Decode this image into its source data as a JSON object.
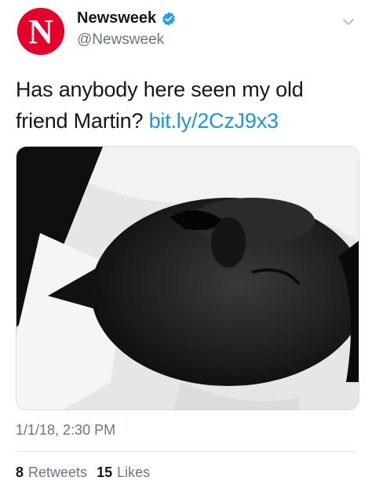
{
  "account": {
    "display_name": "Newsweek",
    "handle": "@Newsweek",
    "avatar_letter": "N",
    "verified": true
  },
  "tweet": {
    "text": "Has anybody here seen my old friend Martin?",
    "link": "bit.ly/2CzJ9x3",
    "timestamp": "1/1/18, 2:30 PM"
  },
  "stats": {
    "retweets_count": "8",
    "retweets_label": "Retweets",
    "likes_count": "15",
    "likes_label": "Likes"
  },
  "colors": {
    "brand_red": "#e4002b",
    "link_blue": "#1b95e0",
    "secondary_text": "#657786"
  },
  "icons": [
    "newsweek-logo-icon",
    "verified-badge-icon",
    "chevron-down-icon"
  ]
}
